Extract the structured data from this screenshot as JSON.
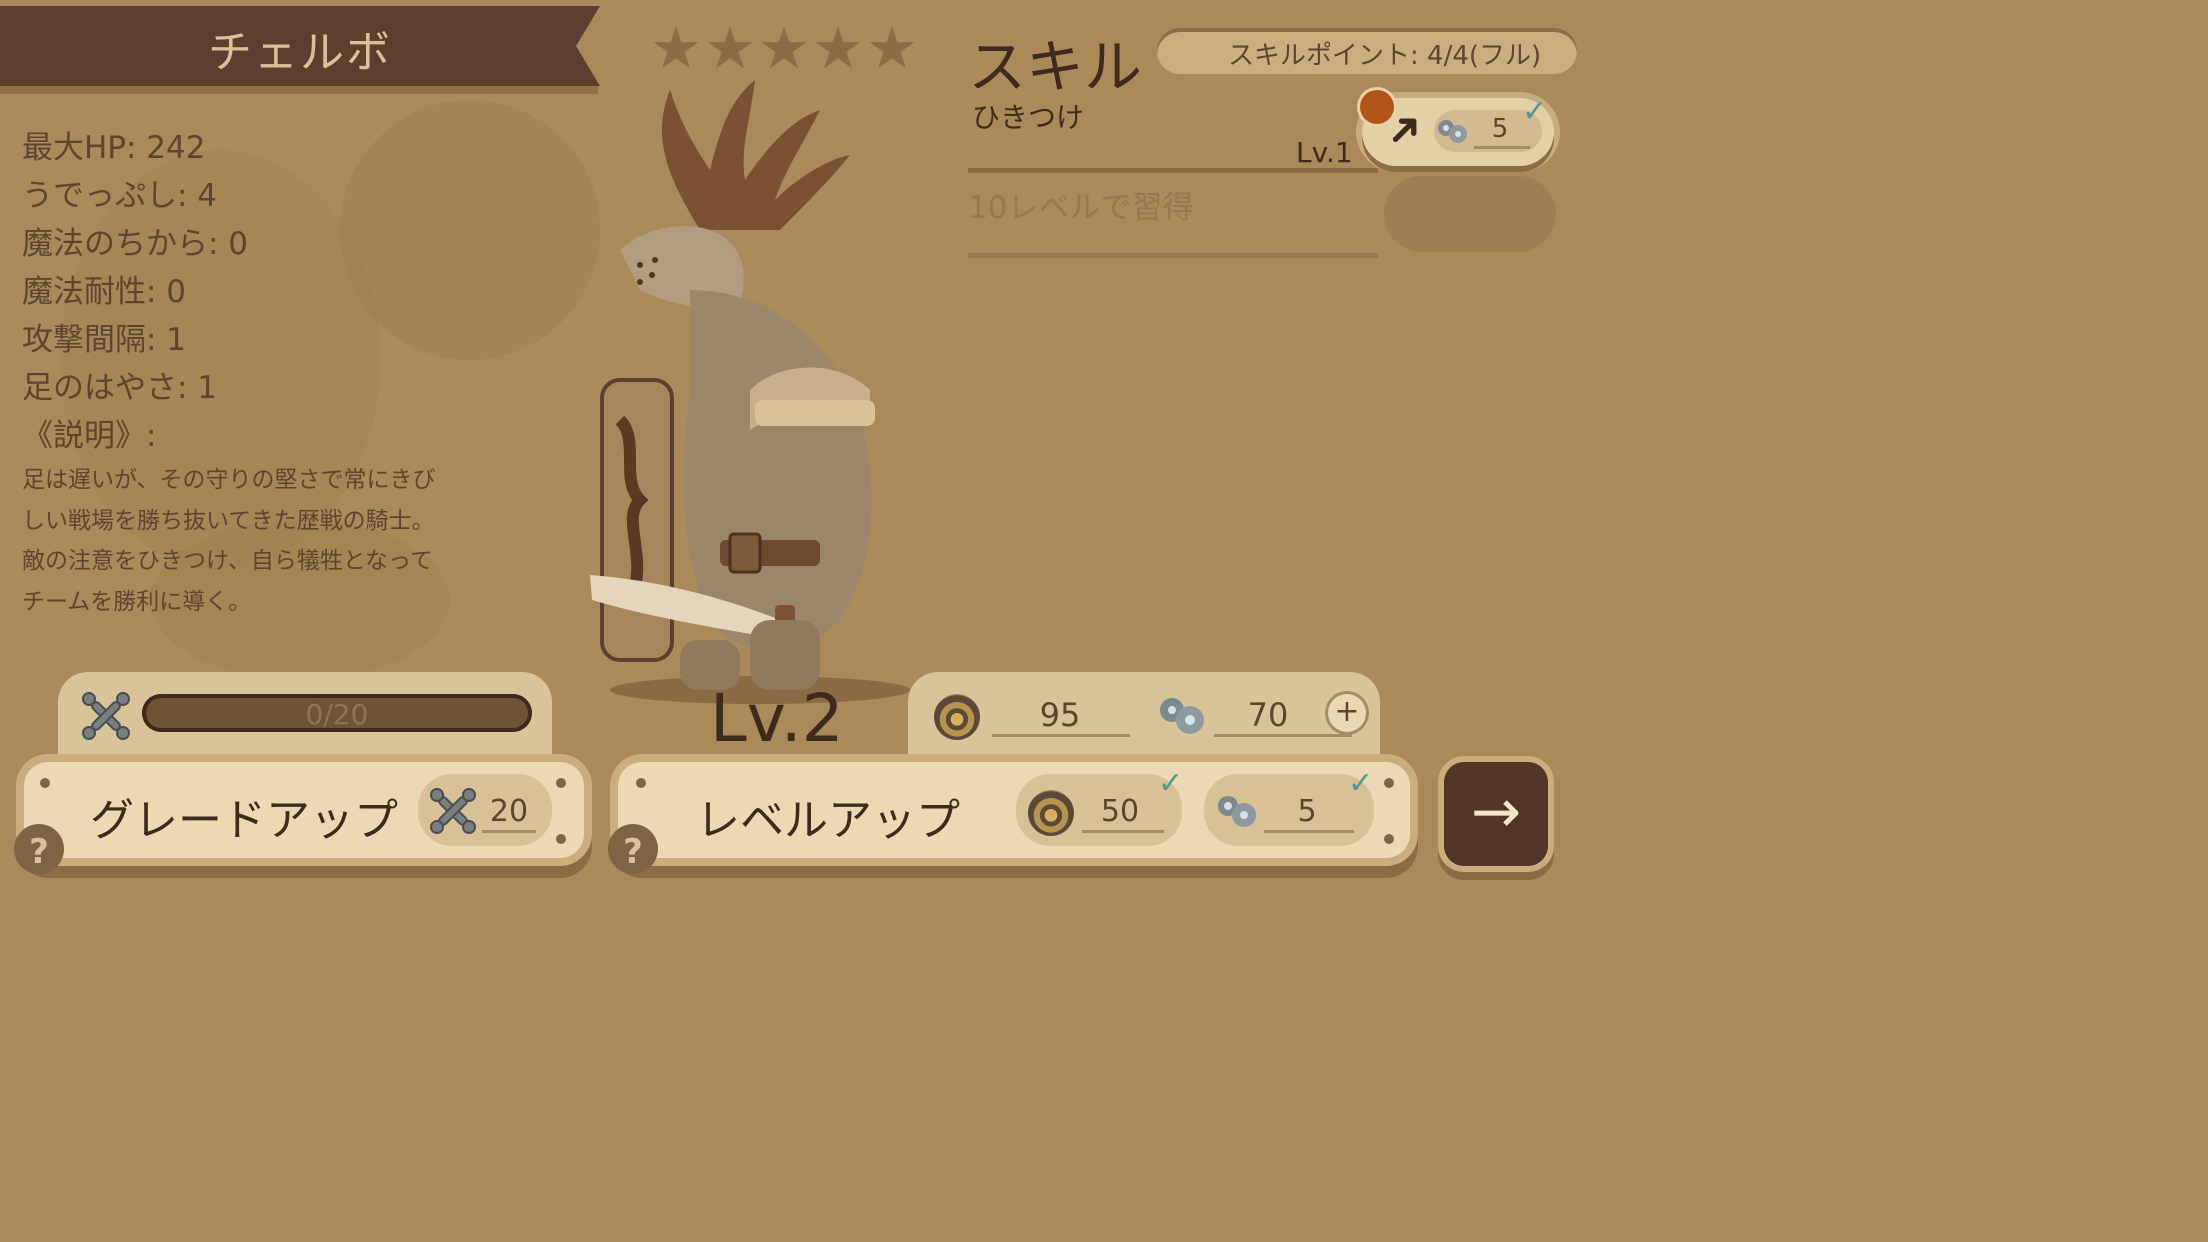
{
  "unit": {
    "name": "チェルボ",
    "stars": 5
  },
  "stats": [
    {
      "label": "最大HP",
      "value": "242"
    },
    {
      "label": "うでっぷし",
      "value": "4"
    },
    {
      "label": "魔法のちから",
      "value": "0"
    },
    {
      "label": "魔法耐性",
      "value": "0"
    },
    {
      "label": "攻撃間隔",
      "value": "1"
    },
    {
      "label": "足のはやさ",
      "value": "1"
    }
  ],
  "stat_lines": [
    "最大HP: 242",
    "うでっぷし: 4",
    "魔法のちから: 0",
    "魔法耐性: 0",
    "攻撃間隔: 1",
    "足のはやさ: 1",
    "《説明》:"
  ],
  "description_lines": [
    "足は遅いが、その守りの堅さで常にきび",
    "しい戦場を勝ち抜いてきた歴戦の騎士。",
    "敵の注意をひきつけ、自ら犠牲となって",
    "チームを勝利に導く。"
  ],
  "skills": {
    "title": "スキル",
    "points_text": "スキルポイント: 4/4(フル)",
    "skill1": {
      "name": "ひきつけ",
      "level": "Lv.1",
      "cost": "5"
    },
    "locked_text": "10レベルで習得"
  },
  "grade": {
    "progress_text": "0/20",
    "progress": 0,
    "button_label": "グレードアップ",
    "cost": "20"
  },
  "level": {
    "current": "Lv.2",
    "gold": "95",
    "gems": "70",
    "button_label": "レベルアップ",
    "cost_gold": "50",
    "cost_gems": "5"
  },
  "help_label": "?",
  "next_label": "→",
  "colors": {
    "background": "#a98a58",
    "banner": "#5b4030",
    "panel": "#d8c499",
    "button": "#ead9b2",
    "dark_text": "#3d2c1e",
    "accent_red": "#b2531a",
    "check": "#4f9a8e"
  },
  "icons": [
    "star-icon",
    "bones-icon",
    "gear-gem-icon",
    "swirl-coin-icon",
    "arrow-icon",
    "check-icon",
    "plus-icon",
    "help-icon",
    "next-arrow-icon"
  ]
}
